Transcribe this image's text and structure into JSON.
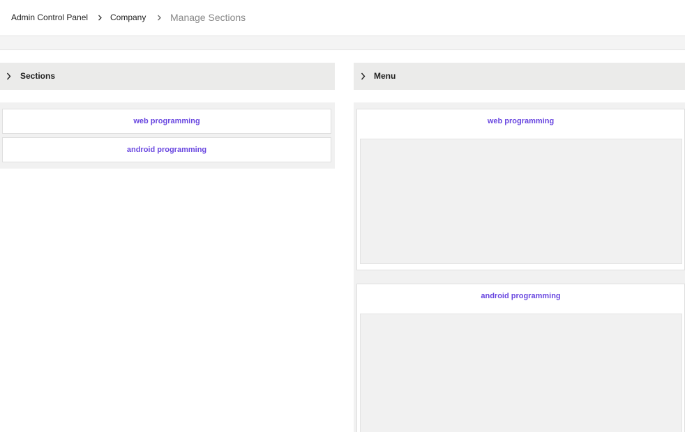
{
  "breadcrumb": {
    "items": [
      "Admin Control Panel",
      "Company",
      "Manage Sections"
    ],
    "separator_icon": "chevron-right-icon"
  },
  "sections_panel": {
    "title": "Sections",
    "items": [
      "web programming",
      "android programming"
    ]
  },
  "menu_panel": {
    "title": "Menu",
    "items": [
      "web programming",
      "android programming"
    ]
  },
  "colors": {
    "link": "#6a48e0",
    "panel_header": "#ebebea",
    "panel_body": "#f1f1f1"
  }
}
